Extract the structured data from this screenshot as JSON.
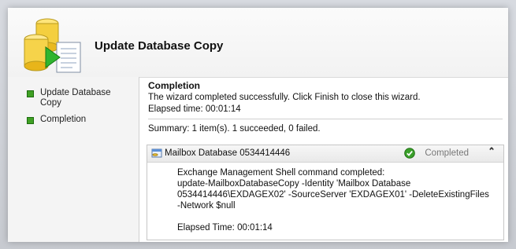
{
  "wizard": {
    "title": "Update Database Copy",
    "steps": [
      {
        "label": "Update Database Copy",
        "lines": [
          "Update Database",
          "Copy"
        ]
      },
      {
        "label": "Completion"
      }
    ]
  },
  "completion": {
    "heading": "Completion",
    "message": "The wizard completed successfully. Click Finish to close this wizard.",
    "elapsed": "Elapsed time: 00:01:14",
    "summary": "Summary: 1 item(s). 1 succeeded, 0 failed."
  },
  "result": {
    "item_name": "Mailbox Database 0534414446",
    "status": "Completed",
    "icons": {
      "item": "database-icon",
      "status": "check-circle-icon",
      "toggle": "double-chevron-up-icon"
    },
    "body_lines": [
      "Exchange Management Shell command completed:",
      "update-MailboxDatabaseCopy -Identity 'Mailbox Database",
      "0534414446\\EXDAGEX02' -SourceServer 'EXDAGEX01' -DeleteExistingFiles",
      "-Network $null"
    ],
    "elapsed": "Elapsed Time: 00:01:14"
  },
  "colors": {
    "step_marker": "#3fa024",
    "status_ok": "#3aa02a"
  }
}
